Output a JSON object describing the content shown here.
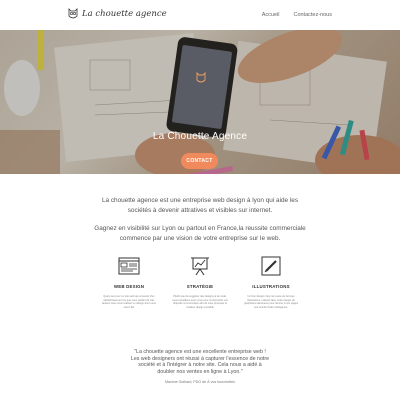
{
  "header": {
    "logo_text": "La chouette agence",
    "nav": [
      {
        "label": "Accueil"
      },
      {
        "label": "Contactez-nous"
      }
    ]
  },
  "hero": {
    "title": "La Chouette Agence",
    "cta_label": "CONTACT"
  },
  "intro": {
    "paragraph_1": "La chouette agence est une entreprise web design à lyon qui aide les sociétés à devenir attratives et visibles sur internet.",
    "paragraph_2": "Gagnez en visibilité sur Lyon ou partout en France,la reussite commerciale commence par une vision de votre entreprise sur le web."
  },
  "services": [
    {
      "icon": "web-design-icon",
      "title": "WEB DESIGN",
      "text": "Quel pour pour un site web qui a besoin d'un rafraîchissement ou que vous parliez de site, laissez-nous vous réaliser un design dont vous serez fier"
    },
    {
      "icon": "strategy-chart-icon",
      "title": "STRATÉGIE",
      "text": "Plutôt que de suggérer des designs à la mode, nous travaillons avec vous pour comprendre vos objectifs commerciaux afin de vous proposer le meilleur design possible"
    },
    {
      "icon": "pen-illustration-icon",
      "title": "ILLUSTRATIONS",
      "text": "Un bon design n'est rien sans de bonnes illustrations. Laissez faire notre équipe de graphistes talentueux pour donner à vos pages une touche finale intelligence."
    }
  ],
  "testimonial": {
    "quote": "\"La chouette agence est une excellente entreprise web ! Les web designers ont réussi à capturer l'essence de notre société et à l'intégrer à notre site. Cela nous a aidé à doubler nos ventes en ligne à Lyon.\"",
    "author": "Maxime Guibard, PDG de À vos fourchettes"
  },
  "colors": {
    "accent": "#f08a5d",
    "text": "#555555"
  }
}
